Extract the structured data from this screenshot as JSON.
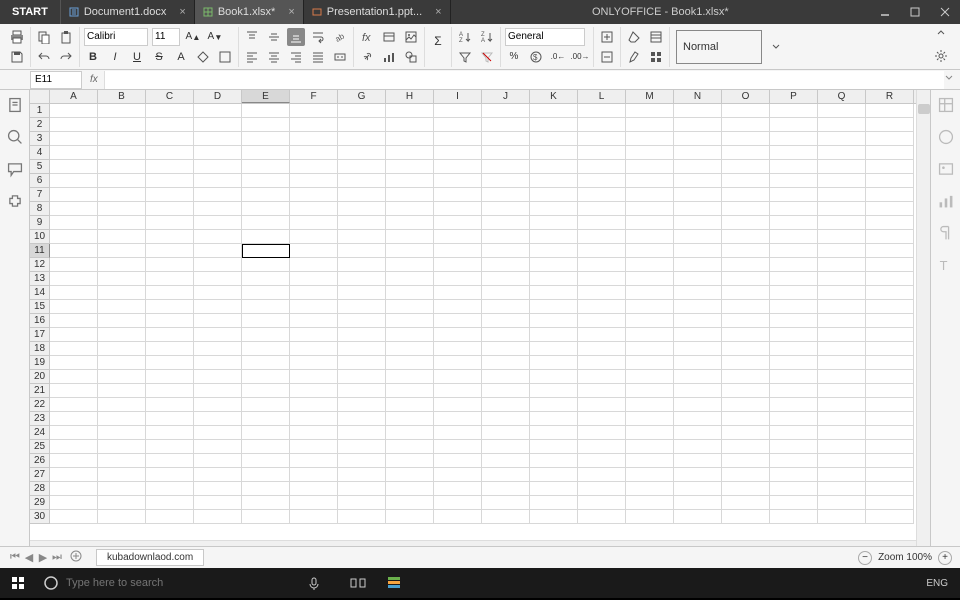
{
  "titlebar": {
    "start_label": "START",
    "app_title": "ONLYOFFICE - Book1.xlsx*",
    "tabs": [
      {
        "label": "Document1.docx",
        "active": false,
        "type": "doc"
      },
      {
        "label": "Book1.xlsx*",
        "active": true,
        "type": "sheet"
      },
      {
        "label": "Presentation1.ppt...",
        "active": false,
        "type": "slide"
      }
    ]
  },
  "toolbar": {
    "font_name": "Calibri",
    "font_size": "11",
    "number_format": "General",
    "style_label": "Normal"
  },
  "namebox": {
    "cell_ref": "E11",
    "fx_label": "fx",
    "formula_value": ""
  },
  "grid": {
    "columns": [
      "A",
      "B",
      "C",
      "D",
      "E",
      "F",
      "G",
      "H",
      "I",
      "J",
      "K",
      "L",
      "M",
      "N",
      "O",
      "P",
      "Q",
      "R"
    ],
    "rows": [
      "1",
      "2",
      "3",
      "4",
      "5",
      "6",
      "7",
      "8",
      "9",
      "10",
      "11",
      "12",
      "13",
      "14",
      "15",
      "16",
      "17",
      "18",
      "19",
      "20",
      "21",
      "22",
      "23",
      "24",
      "25",
      "26",
      "27",
      "28",
      "29",
      "30"
    ],
    "selected_col": "E",
    "selected_row": "11"
  },
  "sheets": {
    "active_sheet": "kubadownlaod.com"
  },
  "status": {
    "zoom_label": "Zoom 100%"
  },
  "taskbar": {
    "search_placeholder": "Type here to search",
    "lang": "ENG"
  }
}
